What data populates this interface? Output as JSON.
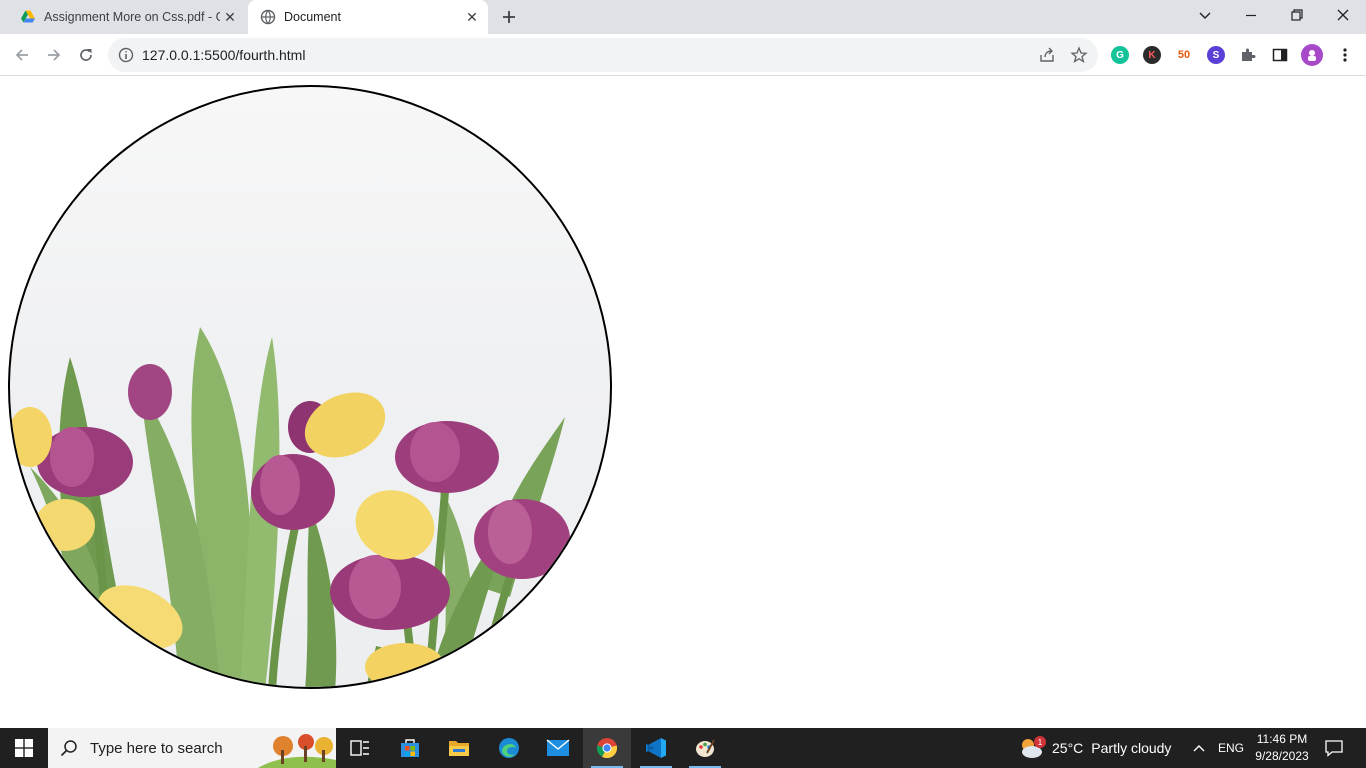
{
  "browser": {
    "tabs": [
      {
        "title": "Assignment More on Css.pdf - G",
        "active": false,
        "favicon": "google-drive-icon"
      },
      {
        "title": "Document",
        "active": true,
        "favicon": "globe-icon"
      }
    ],
    "address": "127.0.0.1:5500/fourth.html",
    "extensions": [
      "grammarly-icon",
      "k-extension-icon",
      "50-extension-icon",
      "s-extension-icon",
      "puzzle-icon",
      "sidepanel-icon",
      "profile-avatar",
      "menu-dots-icon"
    ]
  },
  "page": {
    "image": {
      "subject": "tulips-photo",
      "shape": "circle",
      "border_color": "#000000"
    }
  },
  "taskbar": {
    "search_placeholder": "Type here to search",
    "weather": {
      "temp": "25°C",
      "desc": "Partly cloudy",
      "badge": "1"
    },
    "lang": "ENG",
    "time": "11:46 PM",
    "date": "9/28/2023",
    "apps": [
      "task-view-icon",
      "store-icon",
      "file-explorer-icon",
      "edge-icon",
      "mail-icon",
      "chrome-icon",
      "vscode-icon",
      "paint-icon"
    ]
  },
  "colors": {
    "tabstrip": "#dee1e6",
    "taskbar": "#202020",
    "accent": "#76b9ed"
  }
}
